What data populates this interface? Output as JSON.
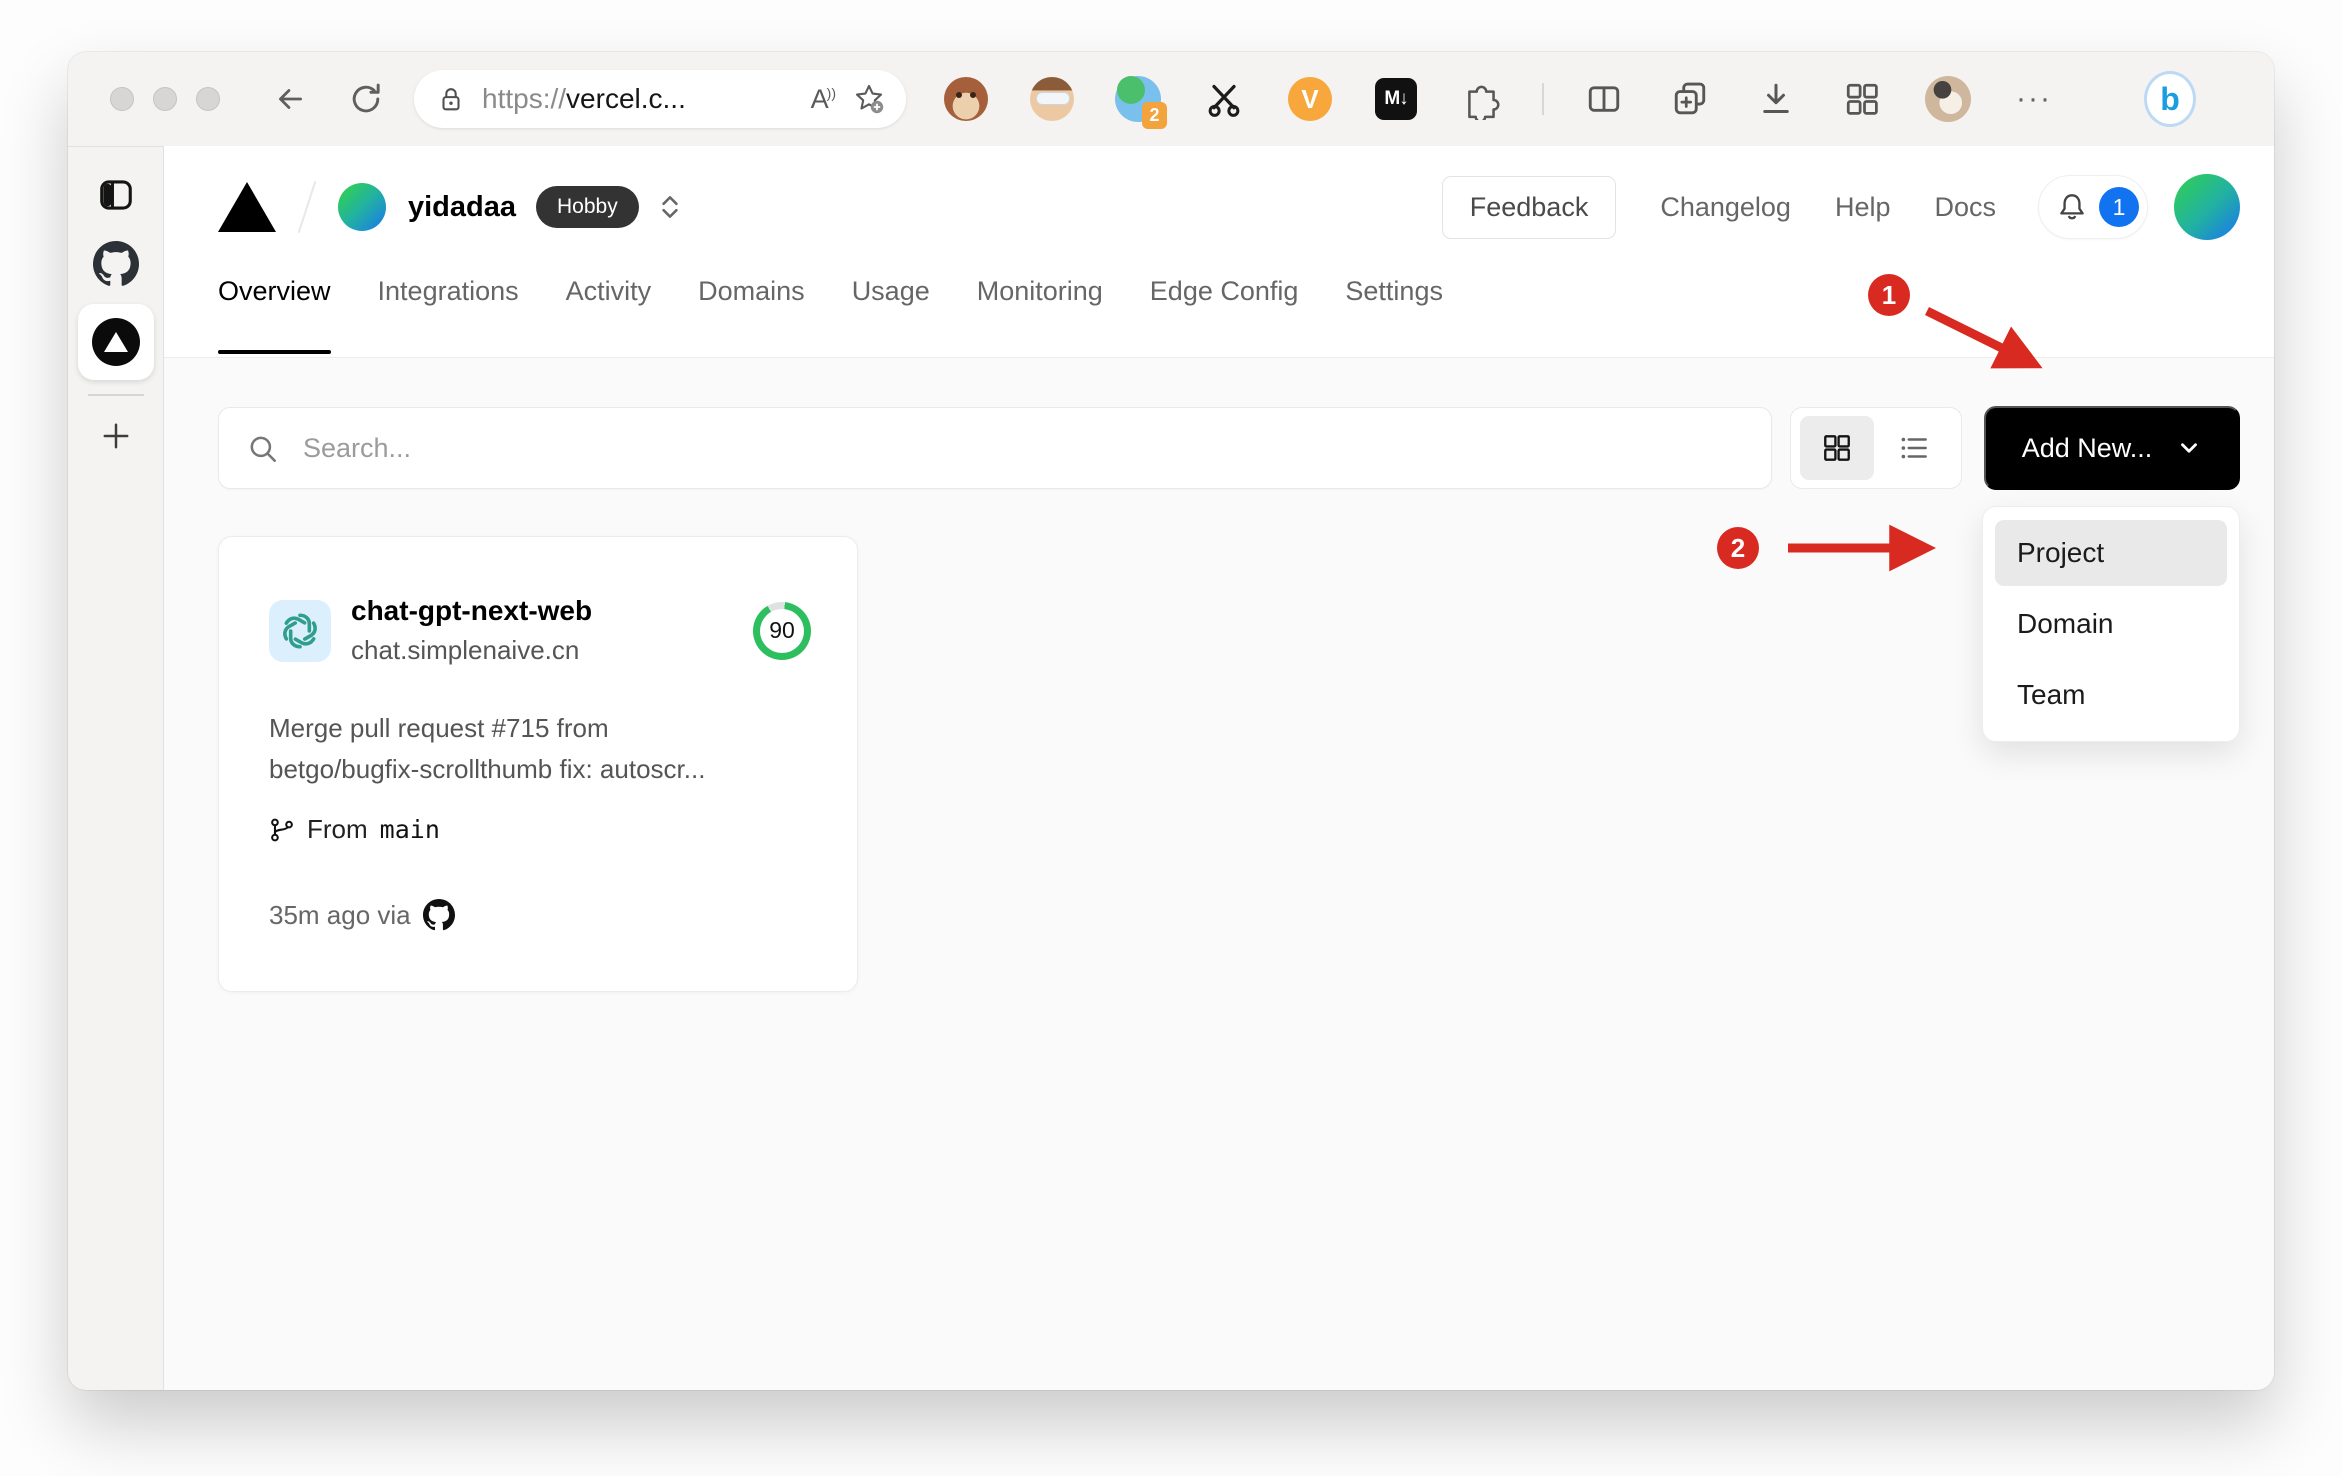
{
  "browser": {
    "url": {
      "scheme": "https://",
      "host": "vercel.c..."
    },
    "extensions": {
      "proxy_badge": "2",
      "v_label": "V",
      "markdown_label": "M↓",
      "bing_label": "b",
      "more_glyph": "···"
    },
    "read_aloud_label": "A",
    "toolbar_icon_names": [
      "traffic-lights",
      "back-arrow",
      "refresh",
      "lock",
      "read-aloud",
      "add-favorite",
      "tampermonkey",
      "avatar-extension",
      "proxy-extension",
      "scissors-extension",
      "v-extension",
      "markdown-extension",
      "extensions-puzzle",
      "split-screen",
      "collections",
      "downloads",
      "apps-grid",
      "profile-avatar",
      "more",
      "bing-chat"
    ],
    "sidebar_icon_names": [
      "panel-toggle",
      "github",
      "vercel-active-tab",
      "new-tab-plus"
    ]
  },
  "vercel": {
    "team": "yidadaa",
    "plan": "Hobby",
    "header": {
      "feedback": "Feedback",
      "links": [
        "Changelog",
        "Help",
        "Docs"
      ],
      "notification_count": "1"
    },
    "tabs": [
      {
        "label": "Overview",
        "active": true
      },
      {
        "label": "Integrations",
        "active": false
      },
      {
        "label": "Activity",
        "active": false
      },
      {
        "label": "Domains",
        "active": false
      },
      {
        "label": "Usage",
        "active": false
      },
      {
        "label": "Monitoring",
        "active": false
      },
      {
        "label": "Edge Config",
        "active": false
      },
      {
        "label": "Settings",
        "active": false
      }
    ],
    "toolbar": {
      "search_placeholder": "Search...",
      "add_new": "Add New..."
    },
    "dropdown": {
      "items": [
        "Project",
        "Domain",
        "Team"
      ],
      "highlighted": "Project"
    },
    "project_card": {
      "name": "chat-gpt-next-web",
      "domain": "chat.simplenaive.cn",
      "score": "90",
      "commit_line1": "Merge pull request #715 from",
      "commit_line2": "betgo/bugfix-scrollthumb fix: autoscr...",
      "branch_label": "From",
      "branch_name": "main",
      "deployed": "35m ago via"
    }
  },
  "annotations": {
    "step1": "1",
    "step2": "2"
  },
  "colors": {
    "annotation_red": "#d92a21",
    "score_green": "#2dbe60",
    "notification_blue": "#1173f0",
    "add_new_bg": "#000000",
    "hobby_badge_bg": "#333333",
    "avatar_gradient_start": "#2fcb5e",
    "avatar_gradient_end": "#1a7ce8"
  }
}
